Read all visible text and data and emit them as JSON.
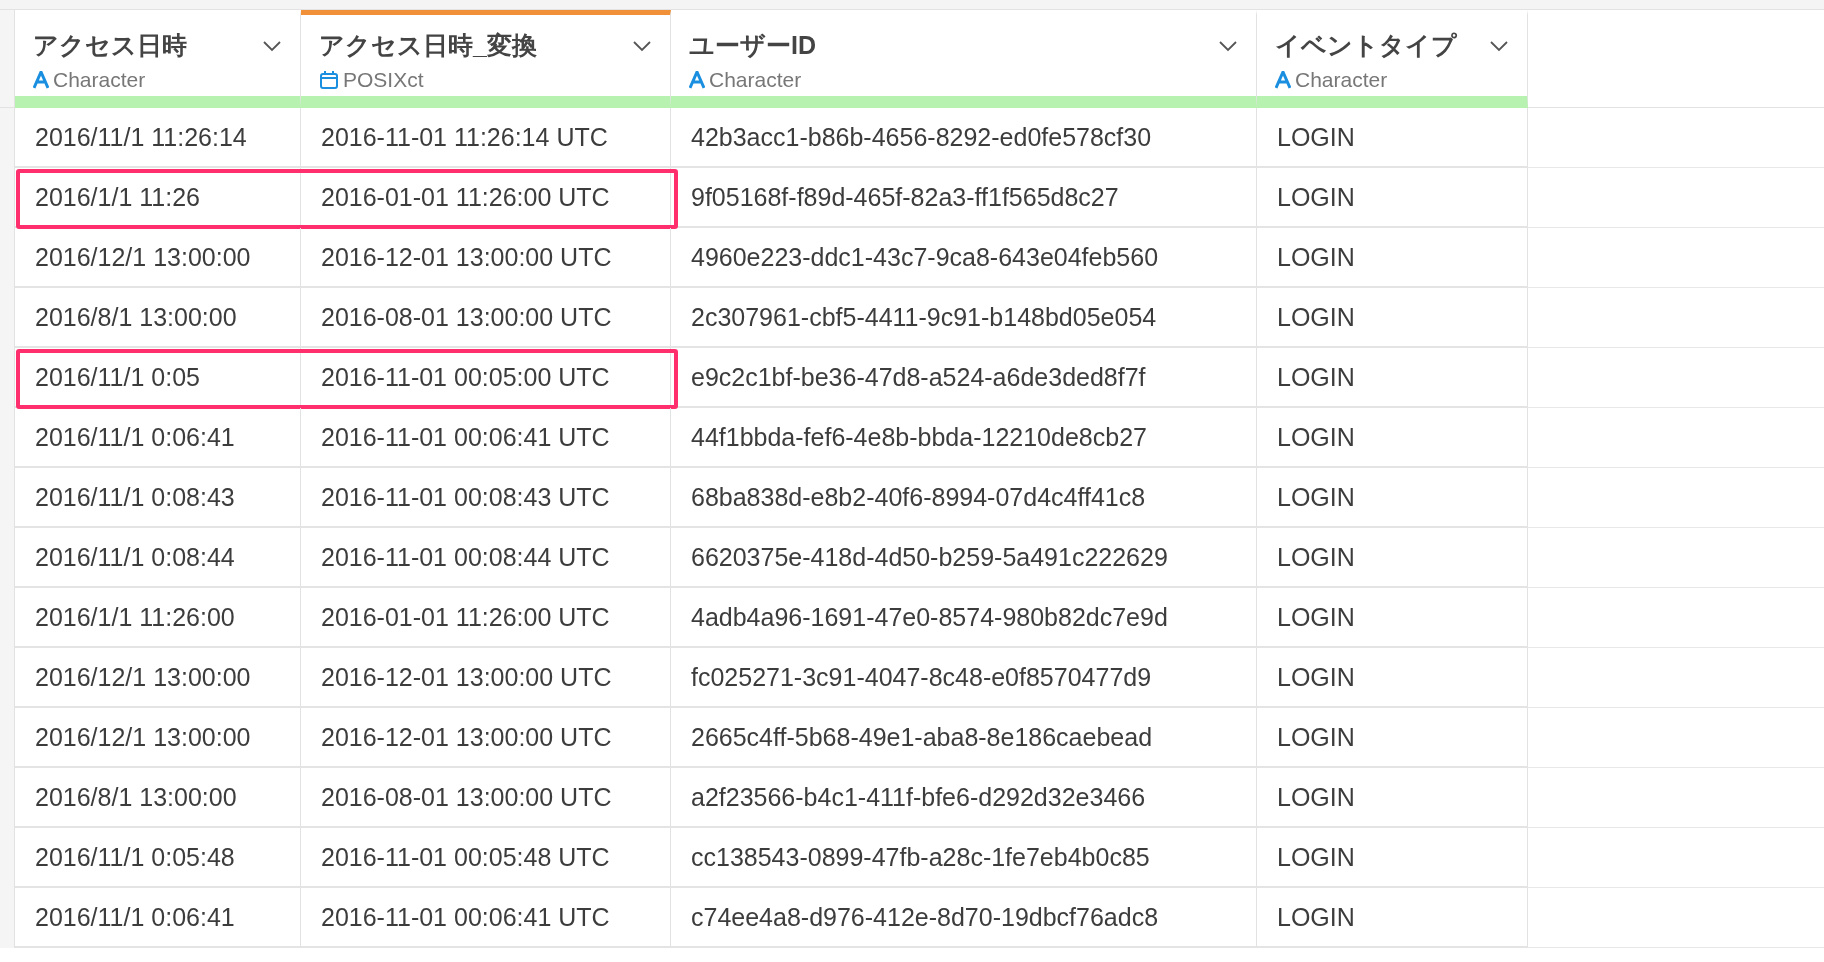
{
  "columns": [
    {
      "name": "アクセス日時",
      "type": "Character",
      "kind": "character",
      "selected": false
    },
    {
      "name": "アクセス日時_変換",
      "type": "POSIXct",
      "kind": "posixct",
      "selected": true
    },
    {
      "name": "ユーザーID",
      "type": "Character",
      "kind": "character",
      "selected": false
    },
    {
      "name": "イベントタイプ",
      "type": "Character",
      "kind": "character",
      "selected": false
    }
  ],
  "rows": [
    {
      "cells": [
        "2016/11/1 11:26:14",
        "2016-11-01 11:26:14 UTC",
        "42b3acc1-b86b-4656-8292-ed0fe578cf30",
        "LOGIN"
      ],
      "highlighted": false
    },
    {
      "cells": [
        "2016/1/1 11:26",
        "2016-01-01 11:26:00 UTC",
        "9f05168f-f89d-465f-82a3-ff1f565d8c27",
        "LOGIN"
      ],
      "highlighted": true
    },
    {
      "cells": [
        "2016/12/1 13:00:00",
        "2016-12-01 13:00:00 UTC",
        "4960e223-ddc1-43c7-9ca8-643e04feb560",
        "LOGIN"
      ],
      "highlighted": false
    },
    {
      "cells": [
        "2016/8/1 13:00:00",
        "2016-08-01 13:00:00 UTC",
        "2c307961-cbf5-4411-9c91-b148bd05e054",
        "LOGIN"
      ],
      "highlighted": false
    },
    {
      "cells": [
        "2016/11/1 0:05",
        "2016-11-01 00:05:00 UTC",
        "e9c2c1bf-be36-47d8-a524-a6de3ded8f7f",
        "LOGIN"
      ],
      "highlighted": true
    },
    {
      "cells": [
        "2016/11/1 0:06:41",
        "2016-11-01 00:06:41 UTC",
        "44f1bbda-fef6-4e8b-bbda-12210de8cb27",
        "LOGIN"
      ],
      "highlighted": false
    },
    {
      "cells": [
        "2016/11/1 0:08:43",
        "2016-11-01 00:08:43 UTC",
        "68ba838d-e8b2-40f6-8994-07d4c4ff41c8",
        "LOGIN"
      ],
      "highlighted": false
    },
    {
      "cells": [
        "2016/11/1 0:08:44",
        "2016-11-01 00:08:44 UTC",
        "6620375e-418d-4d50-b259-5a491c222629",
        "LOGIN"
      ],
      "highlighted": false
    },
    {
      "cells": [
        "2016/1/1 11:26:00",
        "2016-01-01 11:26:00 UTC",
        "4adb4a96-1691-47e0-8574-980b82dc7e9d",
        "LOGIN"
      ],
      "highlighted": false
    },
    {
      "cells": [
        "2016/12/1 13:00:00",
        "2016-12-01 13:00:00 UTC",
        "fc025271-3c91-4047-8c48-e0f8570477d9",
        "LOGIN"
      ],
      "highlighted": false
    },
    {
      "cells": [
        "2016/12/1 13:00:00",
        "2016-12-01 13:00:00 UTC",
        "2665c4ff-5b68-49e1-aba8-8e186caebead",
        "LOGIN"
      ],
      "highlighted": false
    },
    {
      "cells": [
        "2016/8/1 13:00:00",
        "2016-08-01 13:00:00 UTC",
        "a2f23566-b4c1-411f-bfe6-d292d32e3466",
        "LOGIN"
      ],
      "highlighted": false
    },
    {
      "cells": [
        "2016/11/1 0:05:48",
        "2016-11-01 00:05:48 UTC",
        "cc138543-0899-47fb-a28c-1fe7eb4b0c85",
        "LOGIN"
      ],
      "highlighted": false
    },
    {
      "cells": [
        "2016/11/1 0:06:41",
        "2016-11-01 00:06:41 UTC",
        "c74ee4a8-d976-412e-8d70-19dbcf76adc8",
        "LOGIN"
      ],
      "highlighted": false
    }
  ]
}
